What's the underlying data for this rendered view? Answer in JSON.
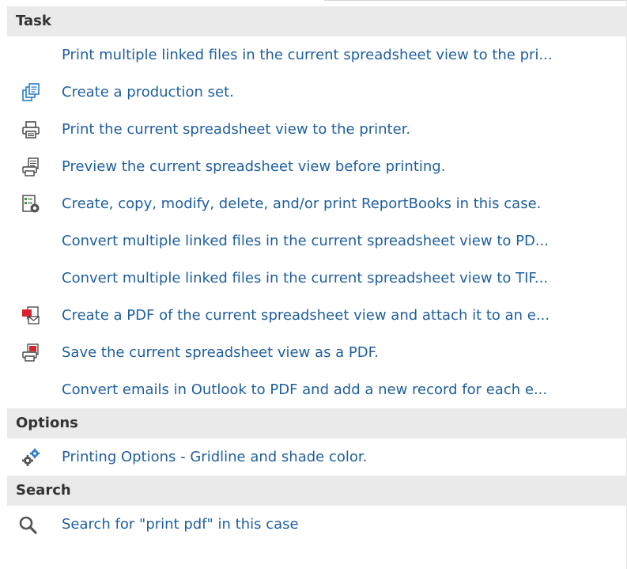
{
  "sections": [
    {
      "header": "Task",
      "items": [
        {
          "label": "Print multiple linked files in the current spreadsheet view to the pri...",
          "icon": "none"
        },
        {
          "label": "Create a production set.",
          "icon": "production-set-icon"
        },
        {
          "label": "Print the current spreadsheet view to the printer.",
          "icon": "printer-icon"
        },
        {
          "label": "Preview the current spreadsheet view before printing.",
          "icon": "print-preview-icon"
        },
        {
          "label": "Create, copy, modify, delete, and/or print ReportBooks in this case.",
          "icon": "reportbook-icon"
        },
        {
          "label": "Convert multiple linked files in the current spreadsheet view to PD...",
          "icon": "none"
        },
        {
          "label": "Convert multiple linked files in the current spreadsheet view to TIF...",
          "icon": "none"
        },
        {
          "label": "Create a PDF of the current spreadsheet view and attach it to an e...",
          "icon": "pdf-email-icon"
        },
        {
          "label": "Save the current spreadsheet view as a PDF.",
          "icon": "pdf-save-icon"
        },
        {
          "label": "Convert emails in Outlook to PDF and add a new record for each e...",
          "icon": "none"
        }
      ]
    },
    {
      "header": "Options",
      "items": [
        {
          "label": "Printing Options - Gridline and shade color.",
          "icon": "gears-icon"
        }
      ]
    },
    {
      "header": "Search",
      "items": [
        {
          "label": "Search for \"print pdf\" in this case",
          "icon": "search-icon"
        }
      ]
    }
  ],
  "colors": {
    "header_bg": "#eaeaea",
    "header_text": "#333333",
    "item_text": "#1f5f9e",
    "accent_blue": "#2e7bc4",
    "accent_red": "#d9232d",
    "accent_green": "#3a9a3a"
  }
}
